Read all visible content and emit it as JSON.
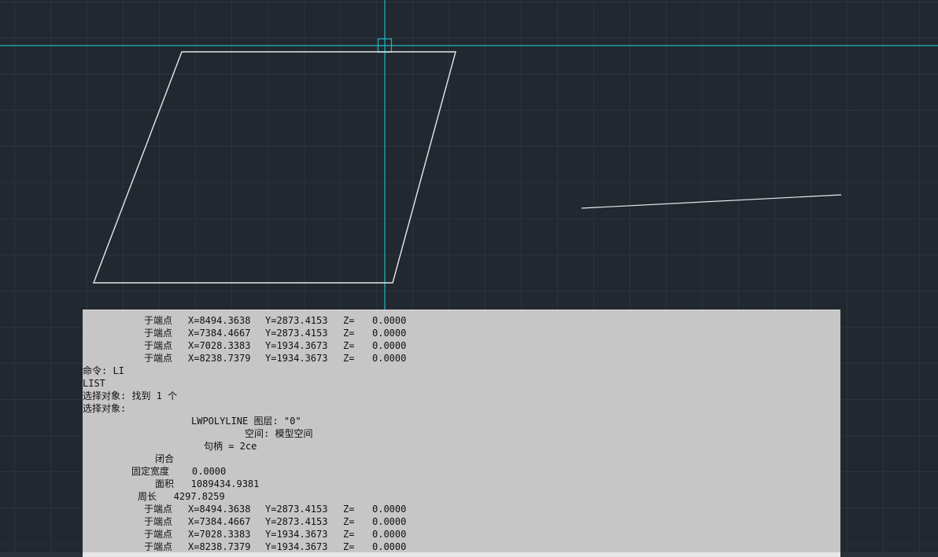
{
  "text_window": {
    "top_vertices": [
      {
        "label": "于端点",
        "x": "X=8494.3638",
        "y": "Y=2873.4153",
        "z": "Z=",
        "zval": "0.0000"
      },
      {
        "label": "于端点",
        "x": "X=7384.4667",
        "y": "Y=2873.4153",
        "z": "Z=",
        "zval": "0.0000"
      },
      {
        "label": "于端点",
        "x": "X=7028.3383",
        "y": "Y=1934.3673",
        "z": "Z=",
        "zval": "0.0000"
      },
      {
        "label": "于端点",
        "x": "X=8238.7379",
        "y": "Y=1934.3673",
        "z": "Z=",
        "zval": "0.0000"
      }
    ],
    "command_line": "命令: LI",
    "list_line": "LIST",
    "select_found": "选择对象: 找到 1 个",
    "select_prompt": "选择对象:",
    "entity_line": "LWPOLYLINE 图层: \"0\"",
    "space_line": "空间: 模型空间",
    "handle_line": "句柄 = 2ce",
    "closed_line": "闭合",
    "width_line": "固定宽度    0.0000",
    "area_line": "面积   1089434.9381",
    "perimeter_line": "周长   4297.8259",
    "bottom_vertices": [
      {
        "label": "于端点",
        "x": "X=8494.3638",
        "y": "Y=2873.4153",
        "z": "Z=",
        "zval": "0.0000"
      },
      {
        "label": "于端点",
        "x": "X=7384.4667",
        "y": "Y=2873.4153",
        "z": "Z=",
        "zval": "0.0000"
      },
      {
        "label": "于端点",
        "x": "X=7028.3383",
        "y": "Y=1934.3673",
        "z": "Z=",
        "zval": "0.0000"
      },
      {
        "label": "于端点",
        "x": "X=8238.7379",
        "y": "Y=1934.3673",
        "z": "Z=",
        "zval": "0.0000"
      }
    ]
  },
  "colors": {
    "background": "#212830",
    "grid": "#2b3340",
    "crosshair": "#22b8bf",
    "geometry": "#e8e8e8",
    "text_window_bg": "#c6c6c6"
  }
}
